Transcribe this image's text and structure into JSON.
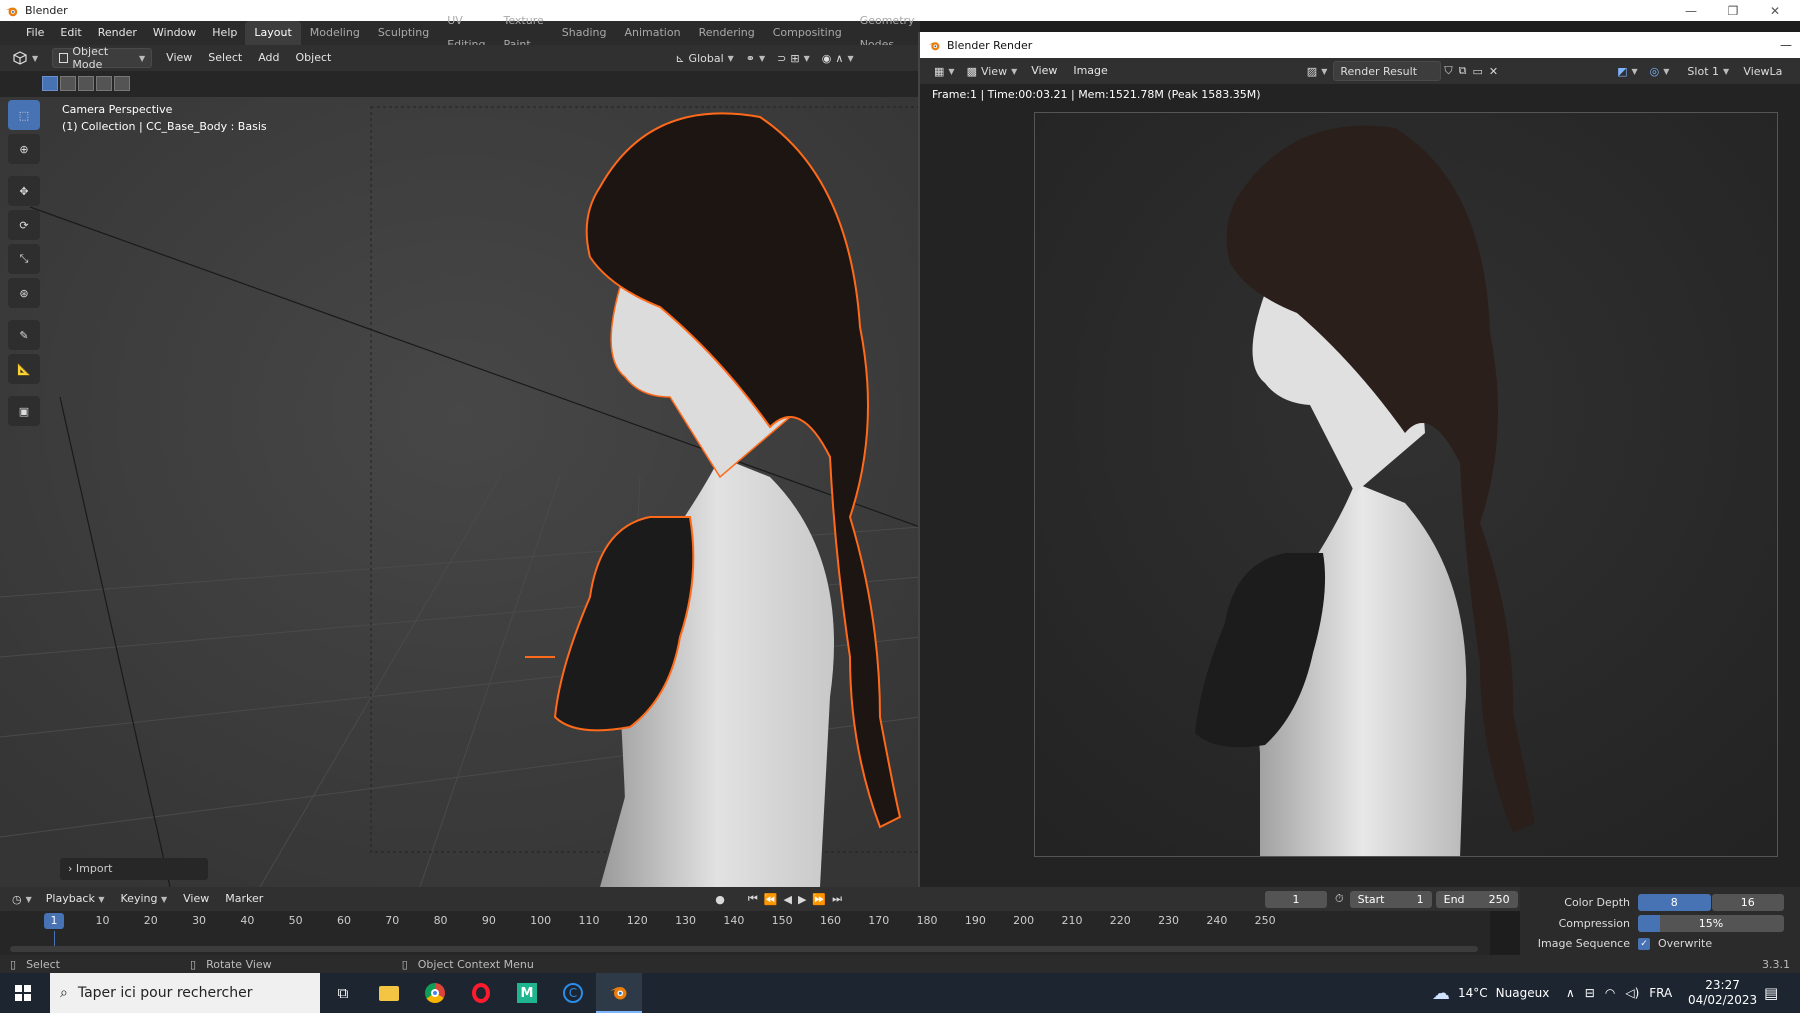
{
  "window": {
    "title": "Blender"
  },
  "topbar": {
    "menus": [
      "File",
      "Edit",
      "Render",
      "Window",
      "Help"
    ],
    "workspaces": [
      "Layout",
      "Modeling",
      "Sculpting",
      "UV Editing",
      "Texture Paint",
      "Shading",
      "Animation",
      "Rendering",
      "Compositing",
      "Geometry Nodes"
    ],
    "active_workspace": "Layout"
  },
  "viewport_header": {
    "mode": "Object Mode",
    "menus": [
      "View",
      "Select",
      "Add",
      "Object"
    ],
    "orientation": "Global"
  },
  "viewport": {
    "view_name": "Camera Perspective",
    "collection_info": "(1) Collection | CC_Base_Body : Basis",
    "import_panel": "Import"
  },
  "render_window": {
    "title": "Blender Render",
    "menus": [
      "View",
      "View",
      "Image"
    ],
    "image_name": "Render Result",
    "slot": "Slot 1",
    "view_layer": "ViewLa",
    "status": "Frame:1 | Time:00:03.21 | Mem:1521.78M (Peak 1583.35M)"
  },
  "timeline": {
    "menus": [
      "Playback",
      "Keying",
      "View",
      "Marker"
    ],
    "current_frame": "1",
    "start_label": "Start",
    "start": "1",
    "end_label": "End",
    "end": "250",
    "ruler_labels": [
      "1",
      "10",
      "20",
      "30",
      "40",
      "50",
      "60",
      "70",
      "80",
      "90",
      "100",
      "110",
      "120",
      "130",
      "140",
      "150",
      "160",
      "170",
      "180",
      "190",
      "200",
      "210",
      "220",
      "230",
      "240",
      "250"
    ]
  },
  "properties": {
    "color_depth_label": "Color Depth",
    "color_depth_options": [
      "8",
      "16"
    ],
    "compression_label": "Compression",
    "compression_value": "15%",
    "compression_fraction": 0.15,
    "image_sequence_label": "Image Sequence",
    "overwrite_label": "Overwrite",
    "overwrite_checked": true
  },
  "statusbar": {
    "select": "Select",
    "rotate": "Rotate View",
    "context_menu": "Object Context Menu",
    "version": "3.3.1"
  },
  "taskbar": {
    "search_placeholder": "Taper ici pour rechercher",
    "weather_temp": "14°C",
    "weather_desc": "Nuageux",
    "language": "FRA",
    "time": "23:27",
    "date": "04/02/2023"
  },
  "colors": {
    "accent": "#4772b3",
    "selection_outline": "#ff6a1a",
    "blender_orange": "#e87d0d"
  }
}
